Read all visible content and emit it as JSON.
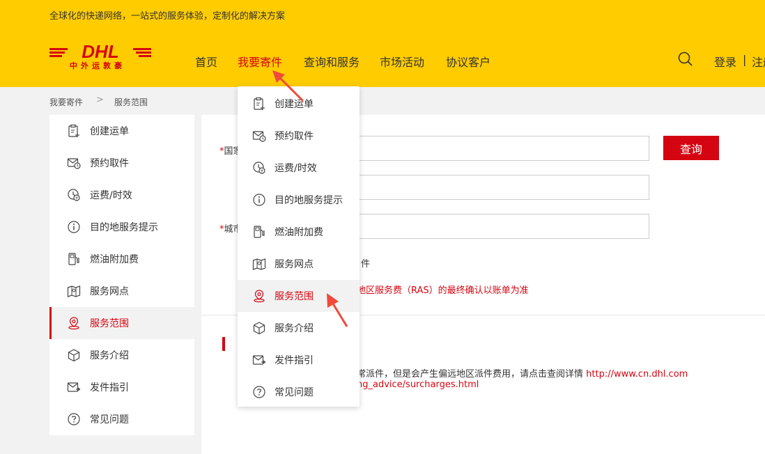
{
  "header": {
    "tagline": "全球化的快递网络，一站式的服务体验，定制化的解决方案",
    "logo_text": "DHL",
    "logo_sub": "中外运敦豪",
    "nav": [
      "首页",
      "我要寄件",
      "查询和服务",
      "市场活动",
      "协议客户"
    ],
    "active_nav": "我要寄件",
    "login": "登录",
    "separator": "|",
    "register": "注册"
  },
  "breadcrumb": {
    "items": [
      "我要寄件",
      "服务范围"
    ],
    "separator": ">"
  },
  "menu_items": [
    {
      "label": "创建运单",
      "icon": "create-waybill-icon"
    },
    {
      "label": "预约取件",
      "icon": "schedule-pickup-icon"
    },
    {
      "label": "运费/时效",
      "icon": "rate-time-icon"
    },
    {
      "label": "目的地服务提示",
      "icon": "info-icon"
    },
    {
      "label": "燃油附加费",
      "icon": "fuel-pump-icon"
    },
    {
      "label": "服务网点",
      "icon": "service-point-icon"
    },
    {
      "label": "服务范围",
      "icon": "location-pin-icon",
      "active": true
    },
    {
      "label": "服务介绍",
      "icon": "box-icon"
    },
    {
      "label": "发件指引",
      "icon": "send-guide-icon"
    },
    {
      "label": "常见问题",
      "icon": "question-icon"
    }
  ],
  "form": {
    "country_label_visible": "国家",
    "city_label_visible": "城市",
    "required_mark": "*",
    "query_button": "查询",
    "partial_option": "件",
    "ras_note": "地区服务费（RAS）的最终确认以账单为准"
  },
  "notice": {
    "line1_text": "常派件，但是会产生偏远地区派件费用，请点击查阅详情 ",
    "line1_link": "http://www.cn.dhl.com",
    "line2_link": "ng_advice/surcharges.html"
  },
  "colors": {
    "brand_yellow": "#ffcc00",
    "brand_red": "#d40511"
  }
}
